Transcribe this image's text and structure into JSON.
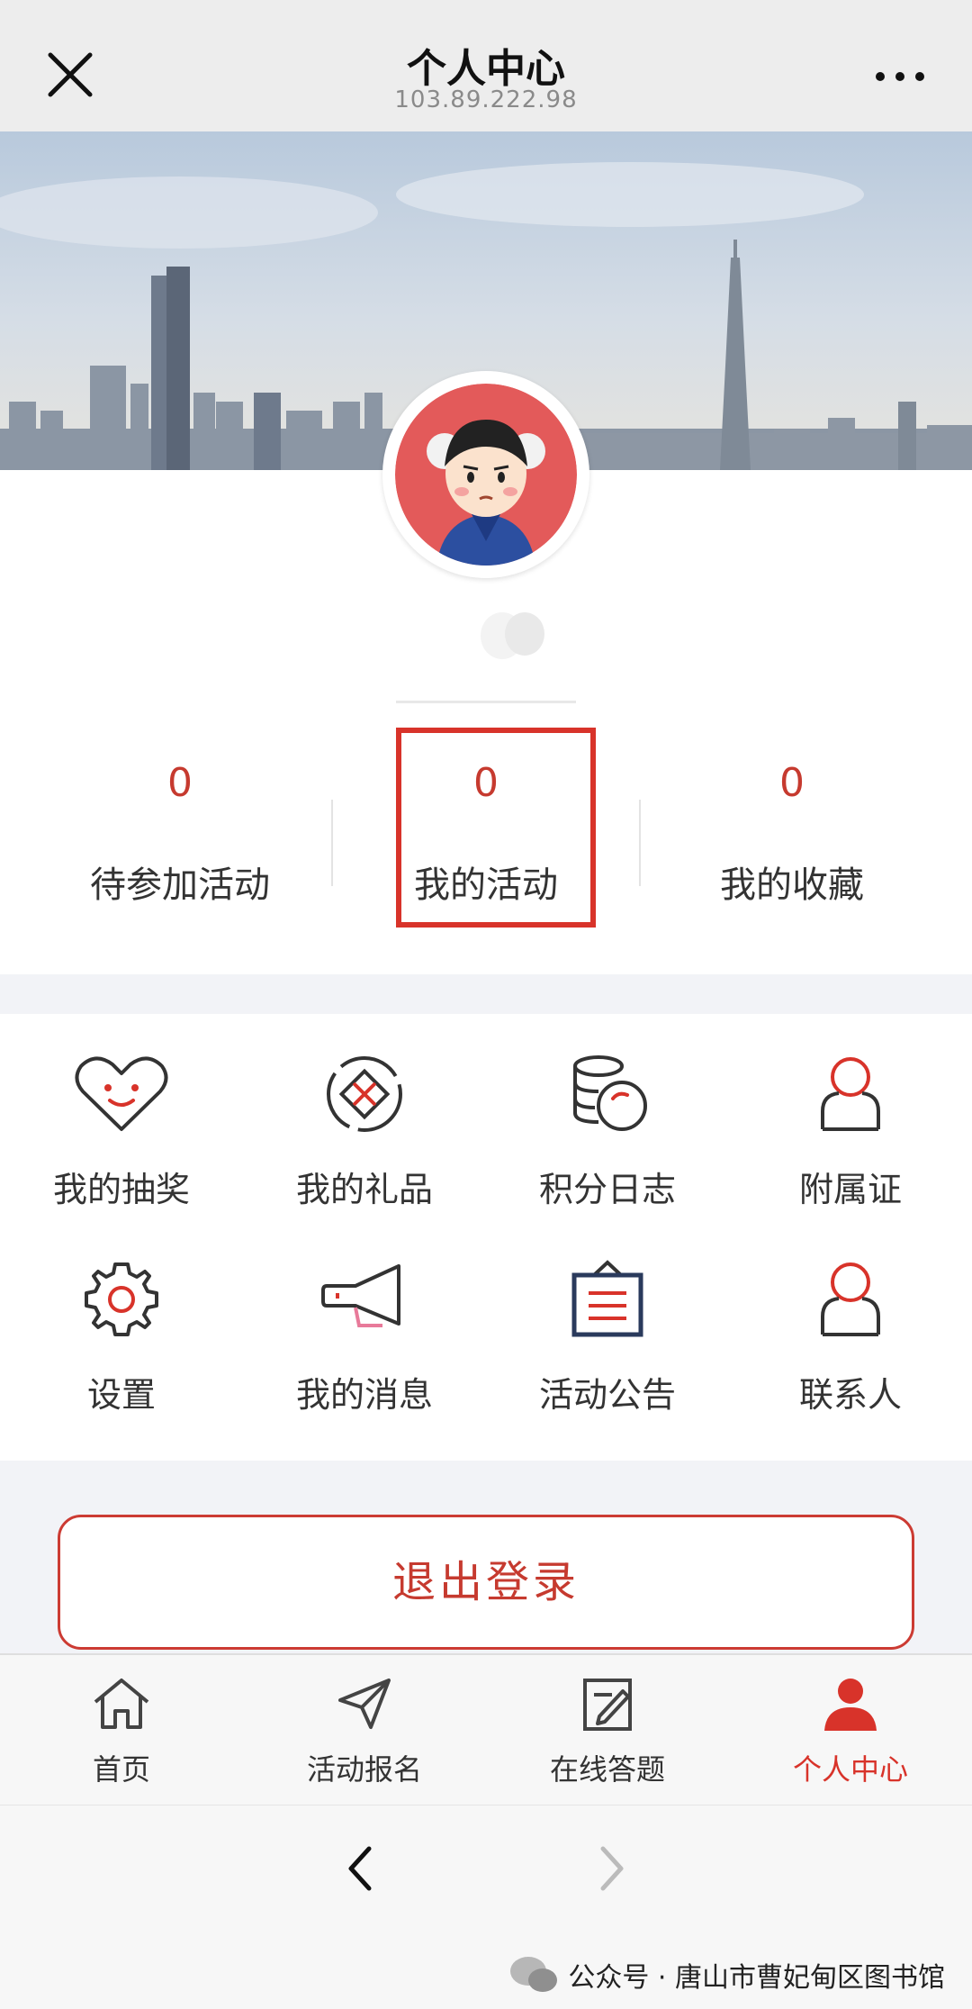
{
  "header": {
    "title": "个人中心",
    "subtitle": "103.89.222.98"
  },
  "stats": [
    {
      "value": "0",
      "label": "待参加活动"
    },
    {
      "value": "0",
      "label": "我的活动"
    },
    {
      "value": "0",
      "label": "我的收藏"
    }
  ],
  "grid": [
    {
      "label": "我的抽奖",
      "icon": "heart-smile-icon"
    },
    {
      "label": "我的礼品",
      "icon": "gift-icon"
    },
    {
      "label": "积分日志",
      "icon": "coins-icon"
    },
    {
      "label": "附属证",
      "icon": "person-icon"
    },
    {
      "label": "设置",
      "icon": "gear-icon"
    },
    {
      "label": "我的消息",
      "icon": "megaphone-icon"
    },
    {
      "label": "活动公告",
      "icon": "notice-board-icon"
    },
    {
      "label": "联系人",
      "icon": "contact-icon"
    }
  ],
  "logout_label": "退出登录",
  "tabs": [
    {
      "label": "首页",
      "icon": "home-icon"
    },
    {
      "label": "活动报名",
      "icon": "send-icon"
    },
    {
      "label": "在线答题",
      "icon": "edit-icon"
    },
    {
      "label": "个人中心",
      "icon": "user-icon",
      "active": true
    }
  ],
  "watermark": "公众号 · 唐山市曹妃甸区图书馆",
  "colors": {
    "accent": "#d8332a",
    "highlight_box": "#d8332a",
    "avatar_bg": "#e35a5a"
  }
}
